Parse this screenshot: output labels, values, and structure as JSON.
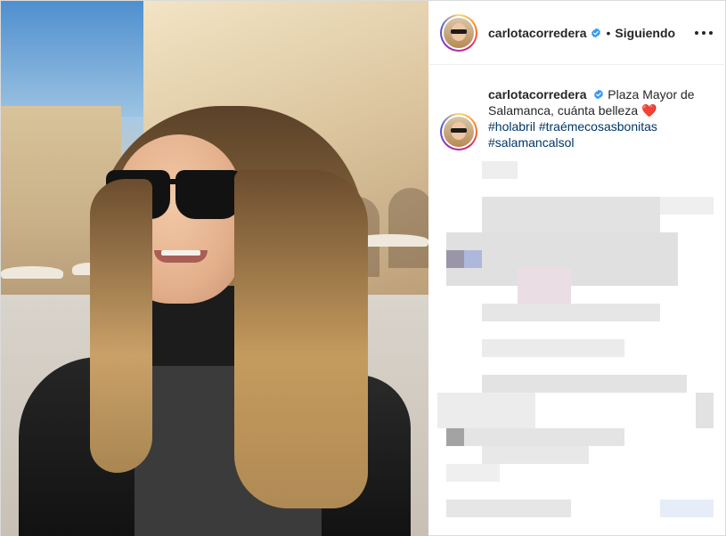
{
  "post": {
    "username": "carlotacorredera",
    "follow_status": "Siguiendo",
    "separator": "•",
    "caption": {
      "username": "carlotacorredera",
      "text_line1": "Plaza Mayor de",
      "text_line2": "Salamanca, cuánta belleza",
      "emoji": "❤️",
      "hashtags": [
        "#holabril",
        "#traémecosasbonitas",
        "#salamancalsol"
      ]
    }
  },
  "icons": {
    "verified": "verified-badge-icon",
    "more": "more-options-icon"
  },
  "colors": {
    "hashtag": "#003569",
    "verified": "#3897f0"
  }
}
